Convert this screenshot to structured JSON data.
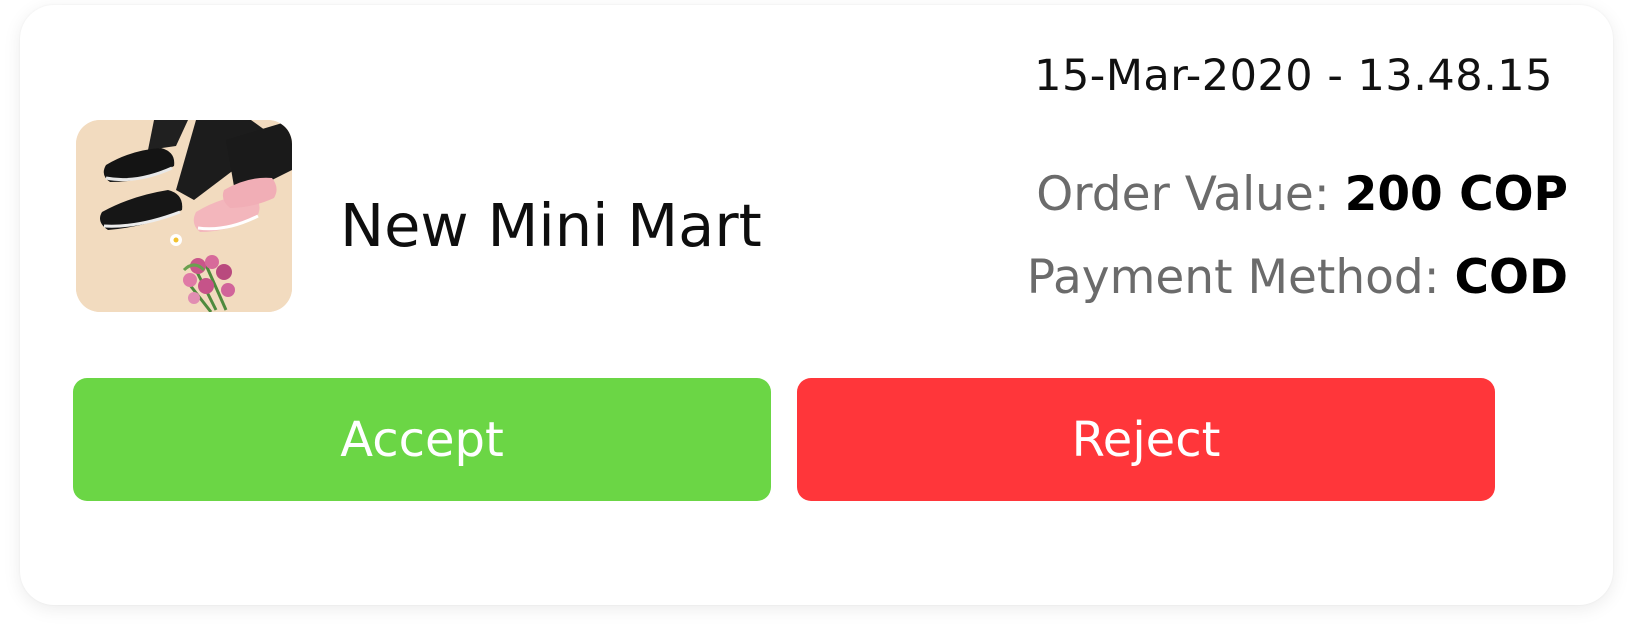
{
  "order": {
    "timestamp": "15-Mar-2020 - 13.48.15",
    "store_name": "New Mini Mart",
    "order_value_label": "Order Value:",
    "order_value": "200 COP",
    "payment_method_label": "Payment Method:",
    "payment_method": "COD"
  },
  "actions": {
    "accept_label": "Accept",
    "reject_label": "Reject"
  },
  "colors": {
    "accept": "#6bd645",
    "reject": "#ff363a"
  },
  "icons": {
    "thumbnail": "product-photo-sneakers"
  }
}
